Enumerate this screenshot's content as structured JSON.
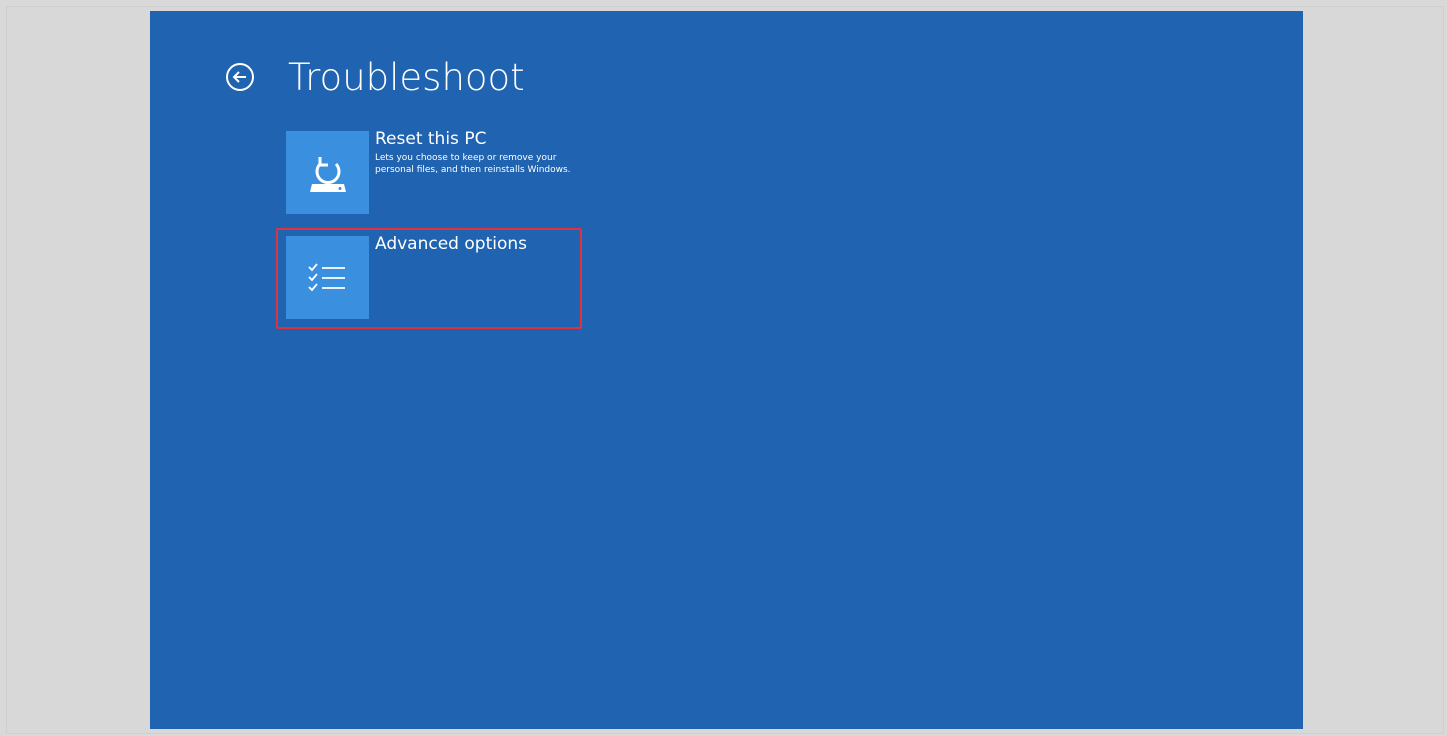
{
  "header": {
    "back_icon": "back-arrow-circle-icon",
    "title": "Troubleshoot"
  },
  "options": [
    {
      "title": "Reset this PC",
      "description": "Lets you choose to keep or remove your personal files, and then reinstalls Windows.",
      "icon": "reset-pc-icon"
    },
    {
      "title": "Advanced options",
      "description": "",
      "icon": "checklist-icon",
      "highlighted": true
    }
  ],
  "colors": {
    "background": "#2063b0",
    "tile": "#3b8fdf",
    "highlight_border": "#e0313e",
    "outer_frame": "#d9d9d9"
  }
}
